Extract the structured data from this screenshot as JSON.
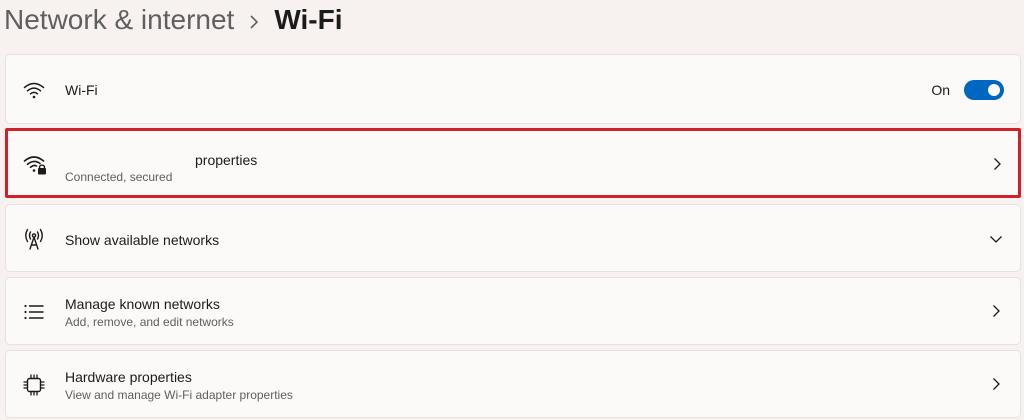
{
  "breadcrumb": {
    "parent": "Network & internet",
    "current": "Wi-Fi"
  },
  "wifi_toggle": {
    "label": "Wi-Fi",
    "state_label": "On",
    "enabled": true
  },
  "connected_network": {
    "title": "properties",
    "status": "Connected, secured"
  },
  "show_networks": {
    "title": "Show available networks"
  },
  "known_networks": {
    "title": "Manage known networks",
    "subtitle": "Add, remove, and edit networks"
  },
  "hardware": {
    "title": "Hardware properties",
    "subtitle": "View and manage Wi-Fi adapter properties"
  },
  "colors": {
    "accent": "#0067c0",
    "highlight_border": "#d0202a",
    "page_background": "#f7f2f0",
    "card_background": "#fbfaf9"
  },
  "icons": {
    "wifi": "wifi-icon",
    "secured_network": "wifi-lock-icon",
    "available_networks": "antenna-icon",
    "known_networks": "list-icon",
    "hardware": "chip-icon",
    "expand": "chevron-down-icon",
    "navigate": "chevron-right-icon"
  }
}
